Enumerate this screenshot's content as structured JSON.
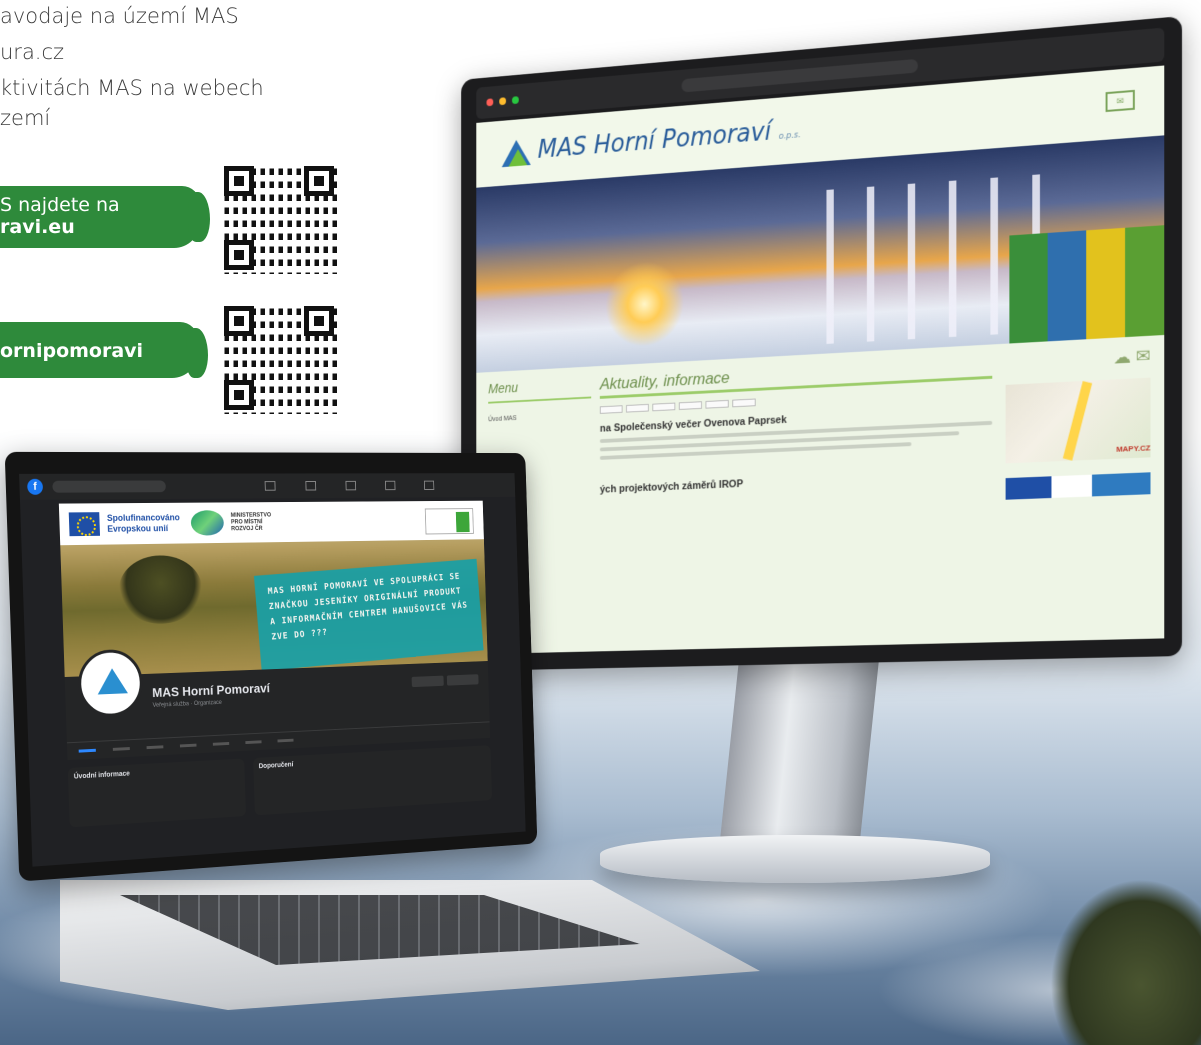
{
  "left_text": {
    "line1": "avodaje na území MAS",
    "line2": "ura.cz",
    "line3": "ktivitách MAS na webech",
    "line4": "zemí"
  },
  "web_banner": {
    "line1": "S najdete na",
    "line2": "ravi.eu"
  },
  "fb_banner": {
    "text": "ornipomoravi"
  },
  "brand_color": "#2e8a3b",
  "monitor": {
    "site_title": "MAS Horní Pomoraví",
    "site_title_suffix": "o.p.s.",
    "menu_label": "Menu",
    "menu_item": "Úvod MAS",
    "news_heading": "Aktuality, informace",
    "article1_title": "na Společenský večer Ovenova Paprsek",
    "article2_title": "ých projektových záměrů IROP",
    "map_label": "MAPY.CZ"
  },
  "laptop": {
    "eu_text": "Spolufinancováno Evropskou unií",
    "mmr_text": "MINISTERSTVO PRO MÍSTNÍ ROZVOJ ČR",
    "cover_text": "MAS HORNÍ POMORAVÍ VE SPOLUPRÁCI SE ZNAČKOU JESENÍKY ORIGINÁLNÍ PRODUKT A INFORMAČNÍM CENTREM HANUŠOVICE VÁS ZVE DO ???",
    "page_name": "MAS Horní Pomoraví",
    "page_category": "Veřejná služba · Organizace",
    "card1_title": "Úvodní informace",
    "card2_title": "Doporučení"
  }
}
